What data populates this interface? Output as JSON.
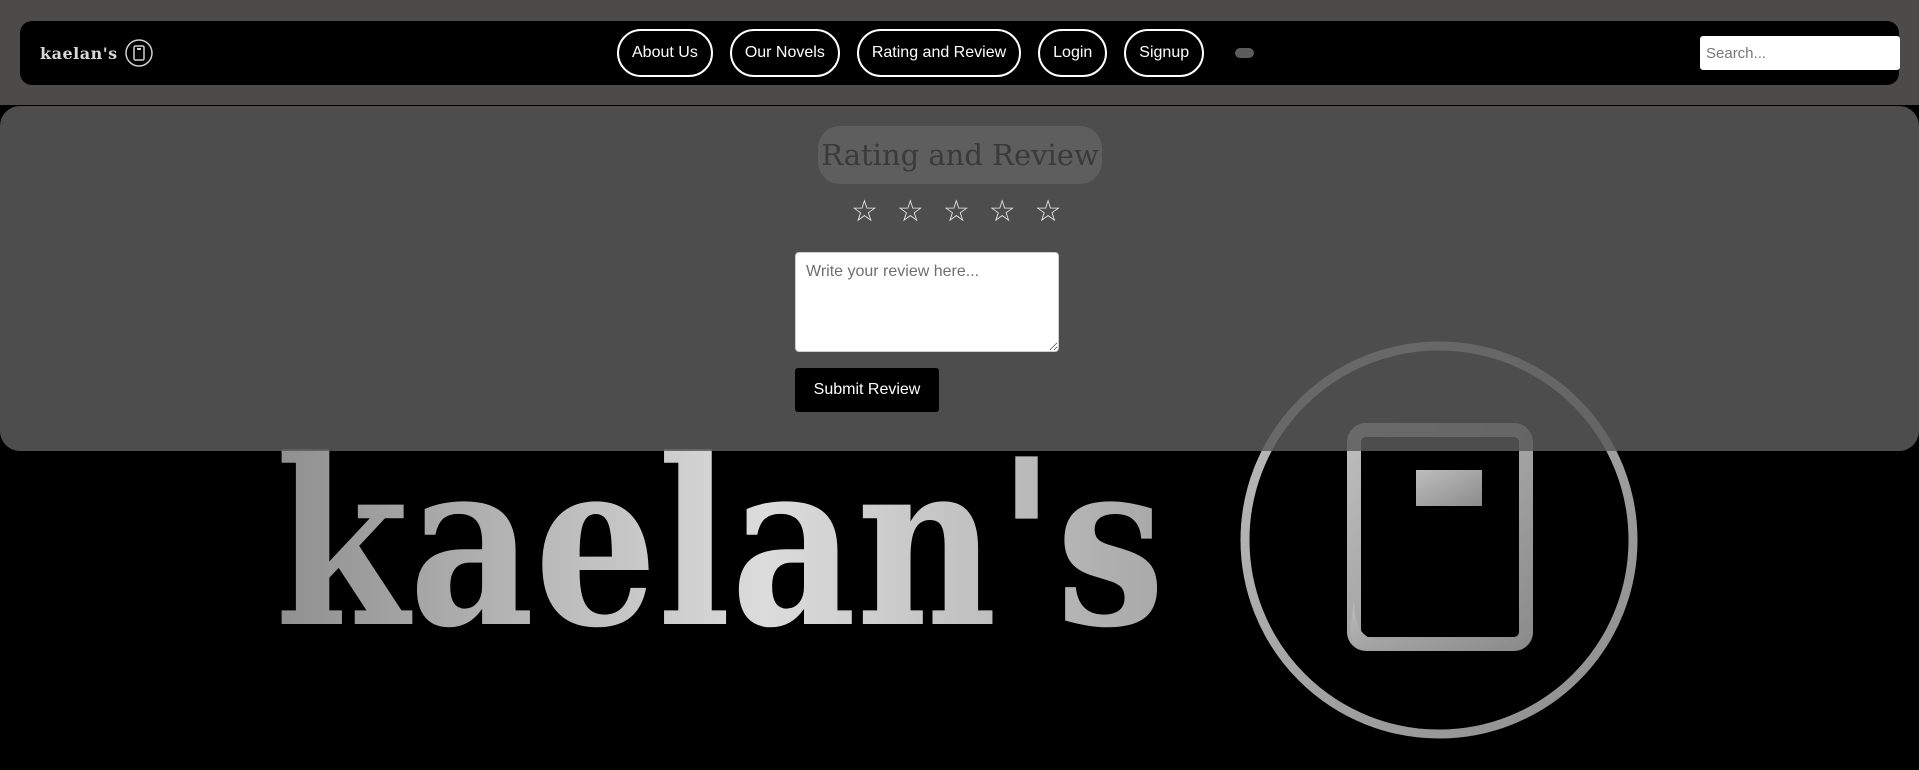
{
  "brand": {
    "name": "kaelan's",
    "icon": "book-circle-icon"
  },
  "nav": {
    "items": [
      {
        "label": "About Us"
      },
      {
        "label": "Our Novels"
      },
      {
        "label": "Rating and Review"
      },
      {
        "label": "Login"
      },
      {
        "label": "Signup"
      }
    ]
  },
  "search": {
    "placeholder": "Search..."
  },
  "review": {
    "title": "Rating and Review",
    "stars": [
      "☆",
      "☆",
      "☆",
      "☆",
      "☆"
    ],
    "textarea_placeholder": "Write your review here...",
    "submit_label": "Submit Review"
  },
  "hero": {
    "logo_text": "kaelan's",
    "icon": "book-circle-icon"
  },
  "colors": {
    "header_band": "#4d4a4a",
    "navbar": "#000000",
    "panel": "#5a5a5a",
    "accent": "#ffffff"
  }
}
